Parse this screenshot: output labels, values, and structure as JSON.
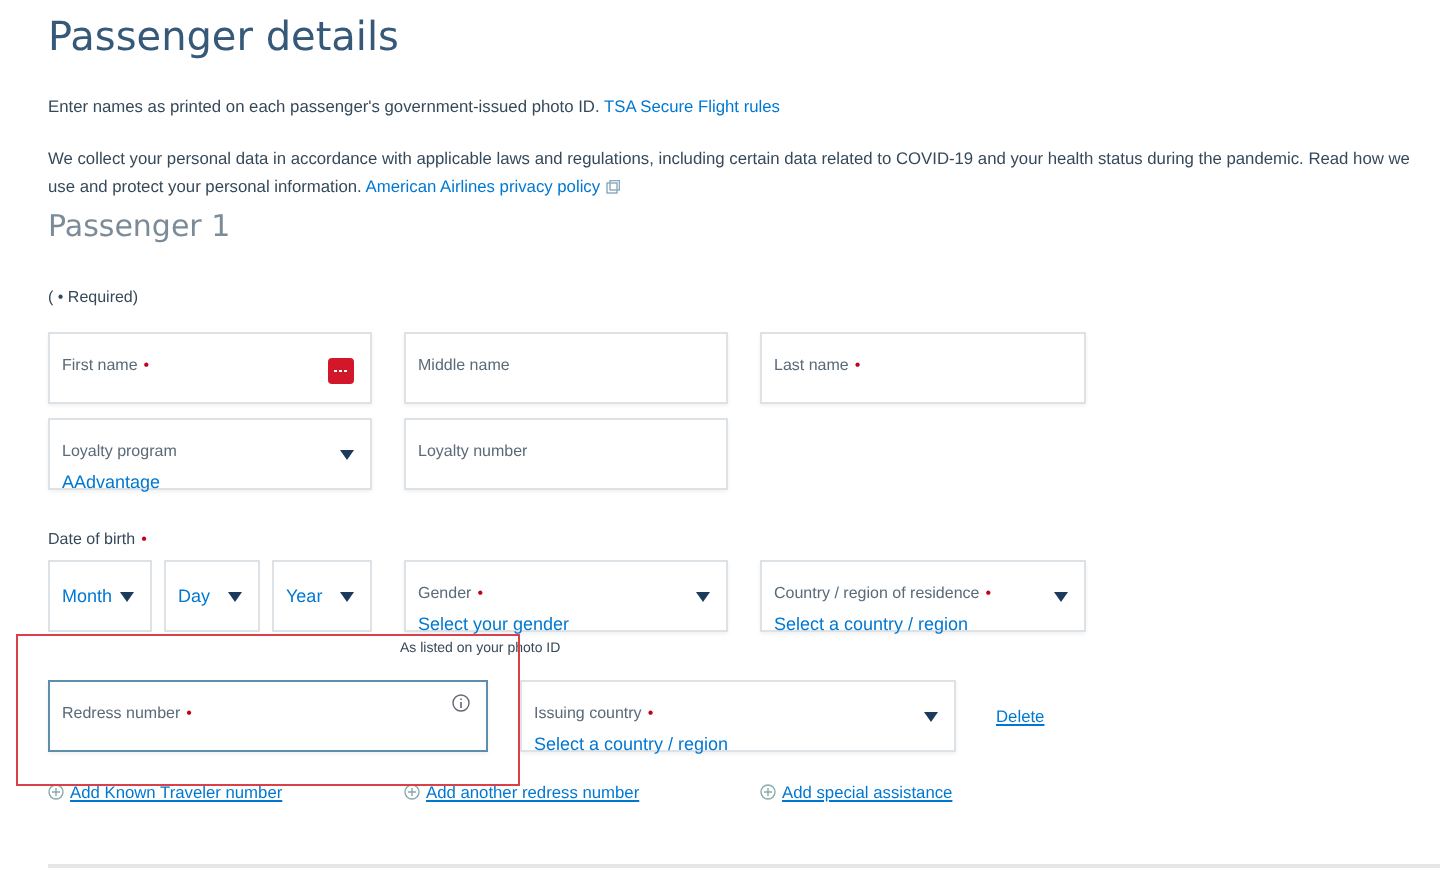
{
  "title": "Passenger details",
  "intro": {
    "text": "Enter names as printed on each passenger's government-issued photo ID.",
    "link": "TSA Secure Flight rules"
  },
  "privacy": {
    "text": "We collect your personal data in accordance with applicable laws and regulations, including certain data related to COVID-19 and your health status during the pandemic. Read how we use and protect your personal information.",
    "link": "American Airlines privacy policy"
  },
  "passenger_heading": "Passenger 1",
  "required_note": "( • Required)",
  "required_symbol": "•",
  "rows": [
    [
      {
        "kind": "text",
        "label": "First name",
        "required": true,
        "autofill": true
      },
      {
        "kind": "text",
        "label": "Middle name",
        "required": false
      },
      {
        "kind": "text",
        "label": "Last name",
        "required": true
      }
    ],
    [
      {
        "kind": "select",
        "label": "Loyalty program",
        "value": "AAdvantage",
        "required": false
      },
      {
        "kind": "text",
        "label": "Loyalty number",
        "required": false
      }
    ]
  ],
  "date_of_birth": {
    "label": "Date of birth",
    "required": true,
    "parts": [
      "Month",
      "Day",
      "Year"
    ]
  },
  "row_3": [
    {
      "kind": "select",
      "label": "Gender",
      "value": "Select your gender",
      "required": true
    },
    {
      "kind": "select",
      "label": "Country / region of residence",
      "value": "Select a country / region",
      "required": true
    }
  ],
  "photo_id_note": "As listed on your photo ID",
  "redress": {
    "label": "Redress number",
    "required": true,
    "focused": true,
    "highlighted": true
  },
  "issuing_country": {
    "label": "Issuing country",
    "value": "Select a country / region",
    "required": true
  },
  "delete_link": "Delete",
  "add_links": [
    "Add Known Traveler number",
    "Add another redress number",
    "Add special assistance"
  ]
}
